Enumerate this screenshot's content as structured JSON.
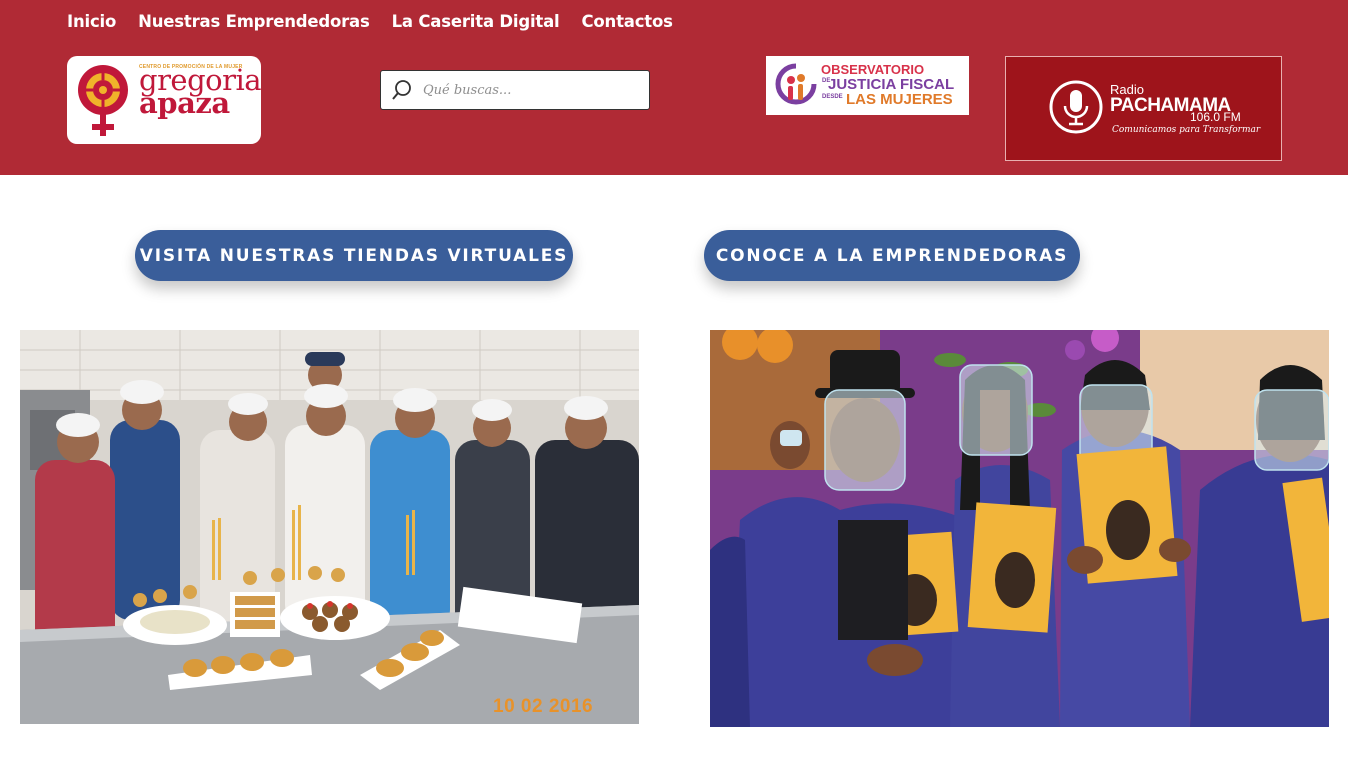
{
  "nav": {
    "items": [
      "Inicio",
      "Nuestras Emprendedoras",
      "La Caserita Digital",
      "Contactos"
    ]
  },
  "logo": {
    "small_text": "CENTRO DE PROMOCIÓN DE LA MUJER",
    "line1": "gregoria",
    "line2": "apaza"
  },
  "search": {
    "placeholder": "Qué buscas..."
  },
  "observatorio": {
    "line1": "OBSERVATORIO",
    "line2_prefix": "DE",
    "line2": "JUSTICIA FISCAL",
    "line3_prefix": "DESDE",
    "line3": "LAS MUJERES"
  },
  "radio": {
    "line1": "Radio",
    "line2": "PACHAMAMA",
    "frequency": "106.0 FM",
    "slogan": "Comunicamos para Transformar"
  },
  "buttons": {
    "stores": "VISITA NUESTRAS TIENDAS VIRTUALES",
    "entrepreneurs": "CONOCE A LA EMPRENDEDORAS"
  },
  "photos": {
    "left_date_stamp": "10 02 2016"
  },
  "colors": {
    "header_bg": "#b02a35",
    "button_bg": "#3a5e9a",
    "radio_bg": "#9e141b"
  }
}
